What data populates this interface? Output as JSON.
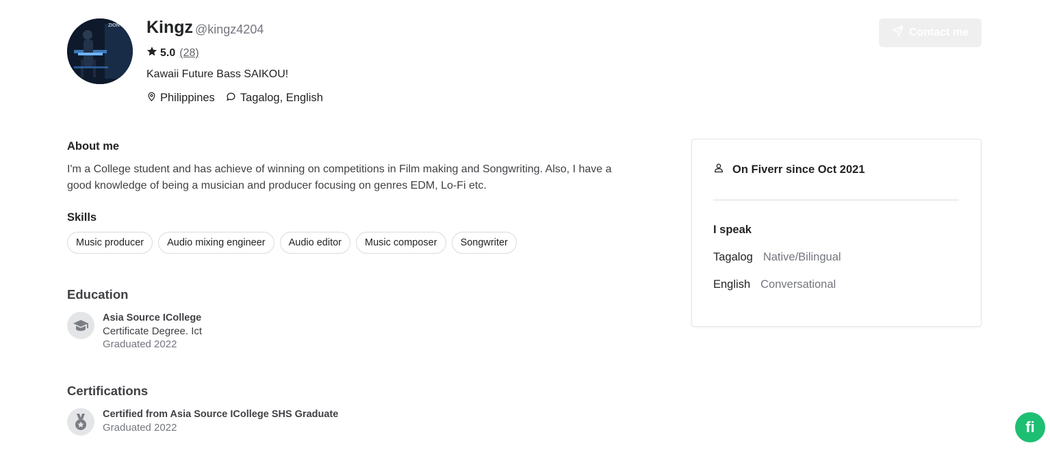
{
  "profile": {
    "name": "Kingz",
    "handle": "@kingz4204",
    "rating": "5.0",
    "review_count": "(28)",
    "tagline": "Kawaii Future Bass SAIKOU!",
    "location": "Philippines",
    "languages_summary": "Tagalog, English",
    "avatar_text": "ZION"
  },
  "contact_button": {
    "label": "Contact me"
  },
  "about": {
    "heading": "About me",
    "text": "I'm a College student and has achieve of winning on competitions in Film making and Songwriting. Also, I have a good knowledge of being a musician and producer focusing on genres EDM, Lo-Fi etc."
  },
  "skills": {
    "heading": "Skills",
    "items": [
      "Music producer",
      "Audio mixing engineer",
      "Audio editor",
      "Music composer",
      "Songwriter"
    ]
  },
  "education": {
    "heading": "Education",
    "school": "Asia Source ICollege",
    "degree": "Certificate Degree. Ict",
    "graduated": "Graduated 2022"
  },
  "certifications": {
    "heading": "Certifications",
    "title": "Certified from Asia Source ICollege SHS Graduate",
    "graduated": "Graduated 2022"
  },
  "side_card": {
    "member_since": "On Fiverr since Oct 2021",
    "speak_heading": "I speak",
    "languages": [
      {
        "language": "Tagalog",
        "level": "Native/Bilingual"
      },
      {
        "language": "English",
        "level": "Conversational"
      }
    ]
  },
  "fab": {
    "label": "fi"
  },
  "colors": {
    "brand_green": "#1dbf73",
    "text_primary": "#222325",
    "text_muted": "#74767e",
    "border": "#dadbdd"
  }
}
